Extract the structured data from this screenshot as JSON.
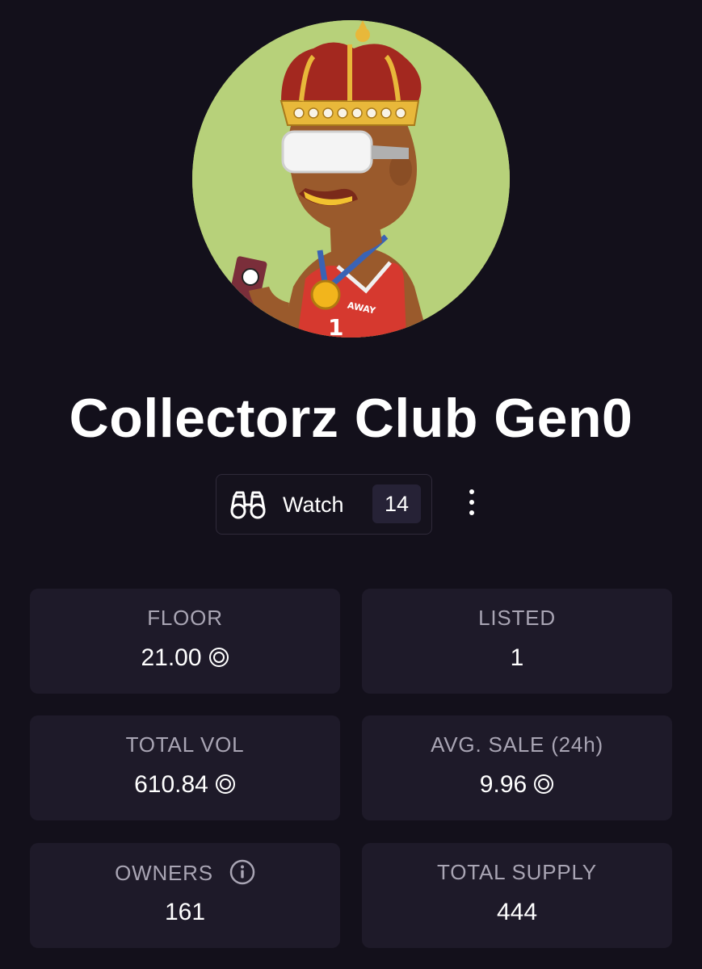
{
  "collection": {
    "title": "Collectorz Club Gen0"
  },
  "avatar": {
    "jersey_text": "AWAY",
    "jersey_number": "1"
  },
  "watch": {
    "label": "Watch",
    "count": "14"
  },
  "stats": {
    "floor": {
      "label": "FLOOR",
      "value": "21.00"
    },
    "listed": {
      "label": "LISTED",
      "value": "1"
    },
    "total_vol": {
      "label": "TOTAL VOL",
      "value": "610.84"
    },
    "avg_sale": {
      "label": "AVG. SALE (24h)",
      "value": "9.96"
    },
    "owners": {
      "label": "OWNERS",
      "value": "161"
    },
    "total_supply": {
      "label": "TOTAL SUPPLY",
      "value": "444"
    }
  },
  "icons": {
    "watch": "binoculars-icon",
    "menu": "vertical-ellipsis-icon",
    "currency": "currency-circle-icon",
    "info": "info-icon"
  },
  "colors": {
    "background": "#13101b",
    "card": "#1e1a29",
    "label": "#a9a5b4",
    "badge": "#262236",
    "avatar_bg": "#b7d17a"
  }
}
